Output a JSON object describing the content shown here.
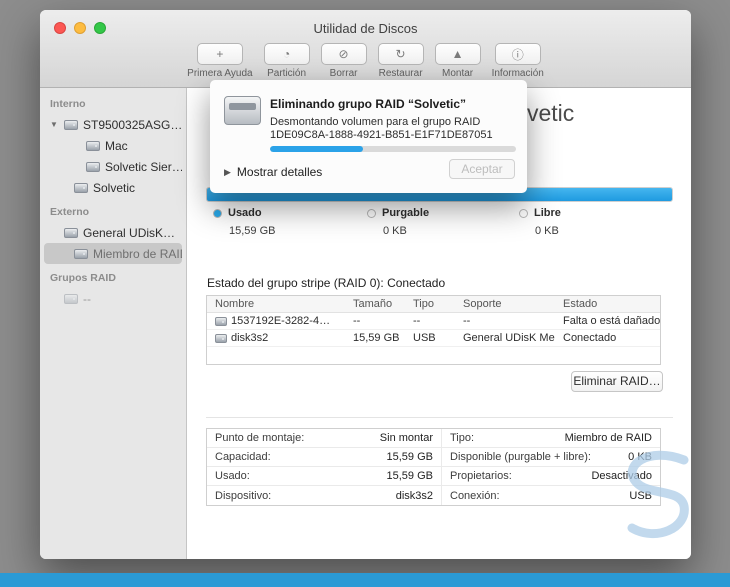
{
  "window": {
    "title": "Utilidad de Discos"
  },
  "toolbar": {
    "items": [
      {
        "label": "Primera Ayuda",
        "glyph": "+"
      },
      {
        "label": "Partición",
        "glyph": "◔"
      },
      {
        "label": "Borrar",
        "glyph": "⊘"
      },
      {
        "label": "Restaurar",
        "glyph": "↻"
      },
      {
        "label": "Montar",
        "glyph": "▲"
      },
      {
        "label": "Información",
        "glyph": "ⓘ"
      }
    ]
  },
  "sidebar": {
    "sections": [
      {
        "header": "Interno",
        "items": [
          {
            "label": "ST9500325ASG…"
          },
          {
            "label": "Mac"
          },
          {
            "label": "Solvetic Sier…"
          },
          {
            "label": "Solvetic"
          }
        ]
      },
      {
        "header": "Externo",
        "items": [
          {
            "label": "General UDisK…"
          },
          {
            "label": "Miembro de RAID…"
          }
        ]
      },
      {
        "header": "Grupos RAID",
        "items": [
          {
            "label": "--"
          }
        ]
      }
    ]
  },
  "dialog": {
    "title": "Eliminando grupo RAID “Solvetic”",
    "message_line1": "Desmontando volumen para el grupo RAID",
    "message_line2": "1DE09C8A-1888-4921-B851-E1F71DE87051",
    "progress_percent": 38,
    "details_label": "Mostrar detalles",
    "accept_label": "Aceptar"
  },
  "main": {
    "title_visible_fragment": "vetic",
    "capacity": {
      "used_percent": 100
    },
    "legend": [
      {
        "label": "Usado",
        "value": "15,59 GB",
        "dot_color": "#29a9e9"
      },
      {
        "label": "Purgable",
        "value": "0 KB",
        "dot_color": "#ffffff"
      },
      {
        "label": "Libre",
        "value": "0 KB",
        "dot_color": "#ffffff"
      }
    ],
    "raid_status": "Estado del grupo stripe (RAID 0): Conectado",
    "table": {
      "columns": [
        "Nombre",
        "Tamaño",
        "Tipo",
        "Soporte",
        "Estado"
      ],
      "rows": [
        {
          "cells": [
            "1537192E-3282-4…",
            "--",
            "--",
            "--",
            "Falta o está dañado"
          ]
        },
        {
          "cells": [
            "disk3s2",
            "15,59 GB",
            "USB",
            "General UDisK Media",
            "Conectado"
          ]
        }
      ]
    },
    "delete_raid_button": "Eliminar RAID…",
    "info_rows": [
      {
        "left_label": "Punto de montaje:",
        "left_value": "Sin montar",
        "right_label": "Tipo:",
        "right_value": "Miembro de RAID"
      },
      {
        "left_label": "Capacidad:",
        "left_value": "15,59 GB",
        "right_label": "Disponible (purgable + libre):",
        "right_value": "0 KB"
      },
      {
        "left_label": "Usado:",
        "left_value": "15,59 GB",
        "right_label": "Propietarios:",
        "right_value": "Desactivado"
      },
      {
        "left_label": "Dispositivo:",
        "left_value": "disk3s2",
        "right_label": "Conexión:",
        "right_value": "USB"
      }
    ]
  },
  "colors": {
    "accent_blue": "#29a9e9",
    "footer_blue": "#2b9ad5",
    "desktop_gray": "#8d8d8d"
  }
}
